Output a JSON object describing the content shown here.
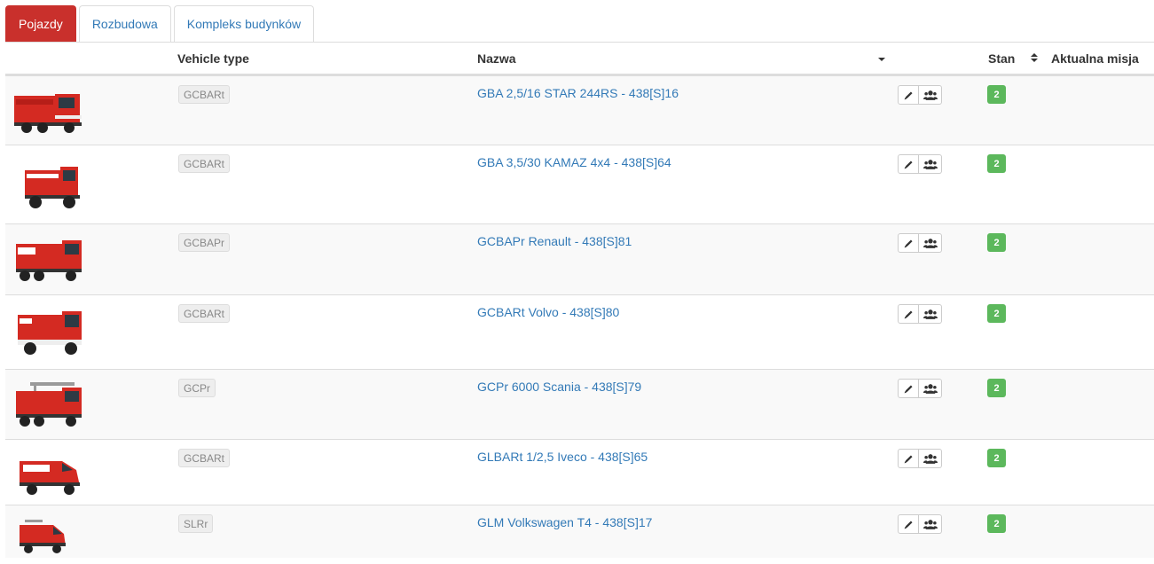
{
  "tabs": [
    {
      "label": "Pojazdy",
      "active": true
    },
    {
      "label": "Rozbudowa",
      "active": false
    },
    {
      "label": "Kompleks budynków",
      "active": false
    }
  ],
  "table": {
    "headers": {
      "vehicle_type": "Vehicle type",
      "name": "Nazwa",
      "status": "Stan",
      "mission": "Aktualna misja"
    },
    "rows": [
      {
        "type": "GCBARt",
        "name": "GBA 2,5/16 STAR 244RS - 438[S]16",
        "status": "2"
      },
      {
        "type": "GCBARt",
        "name": "GBA 3,5/30 KAMAZ 4x4 - 438[S]64",
        "status": "2"
      },
      {
        "type": "GCBAPr",
        "name": "GCBAPr Renault - 438[S]81",
        "status": "2"
      },
      {
        "type": "GCBARt",
        "name": "GCBARt Volvo - 438[S]80",
        "status": "2"
      },
      {
        "type": "GCPr",
        "name": "GCPr 6000 Scania - 438[S]79",
        "status": "2"
      },
      {
        "type": "GCBARt",
        "name": "GLBARt 1/2,5 Iveco - 438[S]65",
        "status": "2"
      },
      {
        "type": "SLRr",
        "name": "GLM Volkswagen T4 - 438[S]17",
        "status": "2"
      }
    ]
  },
  "colors": {
    "tab_active": "#c9302c",
    "link": "#337ab7",
    "status_ok": "#5cb85c"
  },
  "icons": {
    "edit": "pencil-icon",
    "crew": "users-icon",
    "vehicle": "fire-truck-icon"
  }
}
